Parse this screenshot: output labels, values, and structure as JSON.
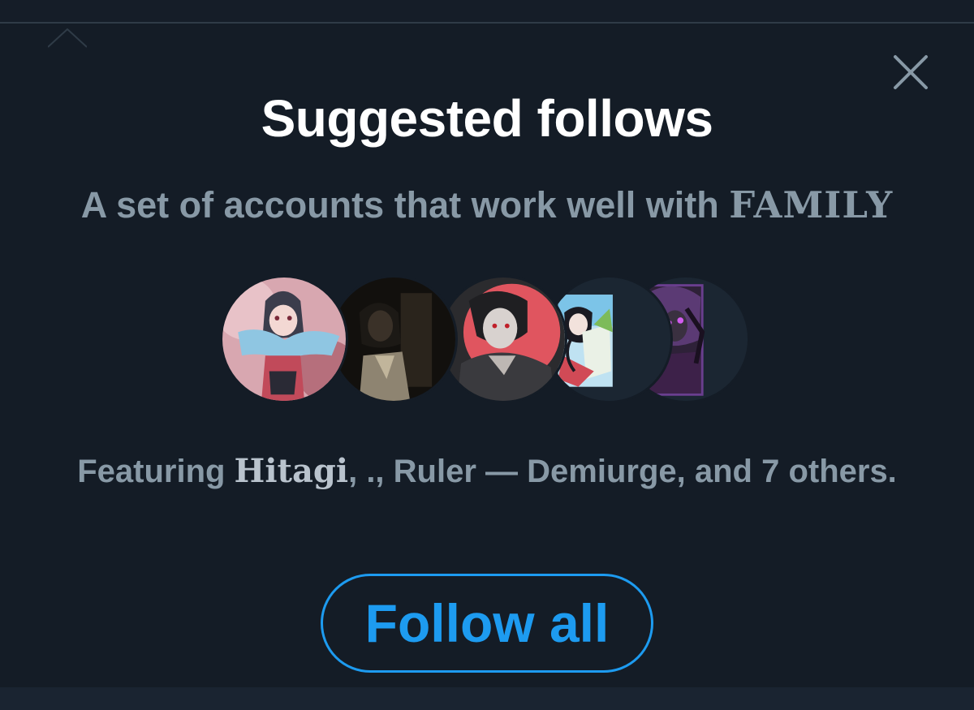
{
  "popover": {
    "title": "Suggested follows",
    "subtitle_prefix": "A set of accounts that work well with ",
    "subtitle_brand": "FAMILY",
    "featuring": {
      "prefix": "Featuring ",
      "name1": "Hitagi",
      "rest": ", ., Ruler — Demiurge, and 7 others."
    },
    "follow_all_label": "Follow all",
    "close_icon": "close-icon"
  },
  "avatars": [
    {
      "name": "avatar-1",
      "icon": "anime-girl-scarf-avatar"
    },
    {
      "name": "avatar-2",
      "icon": "dark-portrait-avatar"
    },
    {
      "name": "avatar-3",
      "icon": "red-moon-portrait-avatar"
    },
    {
      "name": "avatar-4",
      "icon": "anime-duo-avatar"
    },
    {
      "name": "avatar-5",
      "icon": "purple-character-avatar"
    }
  ],
  "colors": {
    "background": "#141c26",
    "title": "#ffffff",
    "muted_text": "#8899a6",
    "accent": "#1d9bf0"
  }
}
